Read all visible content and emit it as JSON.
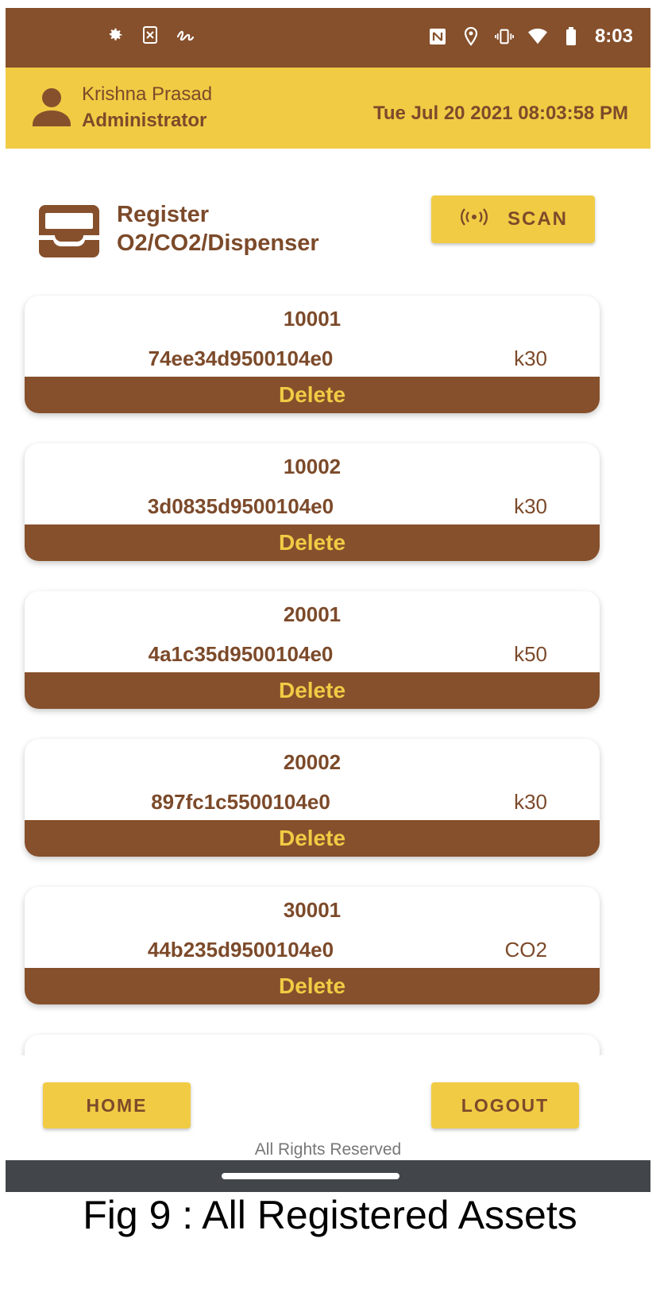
{
  "status_bar": {
    "time": "8:03",
    "left_icons": [
      "gear-icon",
      "sim-x-icon",
      "signature-icon"
    ],
    "right_icons": [
      "nfc-icon",
      "location-icon",
      "vibrate-icon",
      "wifi-icon",
      "battery-icon"
    ]
  },
  "header": {
    "user_name": "Krishna Prasad",
    "user_role": "Administrator",
    "datetime": "Tue Jul 20 2021 08:03:58 PM"
  },
  "page": {
    "title_line1": "Register",
    "title_line2": "O2/CO2/Dispenser",
    "scan_label": "SCAN"
  },
  "assets": [
    {
      "id": "10001",
      "hash": "74ee34d9500104e0",
      "type": "k30",
      "delete_label": "Delete"
    },
    {
      "id": "10002",
      "hash": "3d0835d9500104e0",
      "type": "k30",
      "delete_label": "Delete"
    },
    {
      "id": "20001",
      "hash": "4a1c35d9500104e0",
      "type": "k50",
      "delete_label": "Delete"
    },
    {
      "id": "20002",
      "hash": "897fc1c5500104e0",
      "type": "k30",
      "delete_label": "Delete"
    },
    {
      "id": "30001",
      "hash": "44b235d9500104e0",
      "type": "CO2",
      "delete_label": "Delete"
    }
  ],
  "footer": {
    "home_label": "HOME",
    "logout_label": "LOGOUT",
    "rights_text": "All Rights Reserved"
  },
  "caption": "Fig 9 : All Registered Assets",
  "colors": {
    "brown": "#86502c",
    "yellow": "#f1cb44",
    "text_brown": "#7c4a2a",
    "nav_gray": "#42464b"
  }
}
